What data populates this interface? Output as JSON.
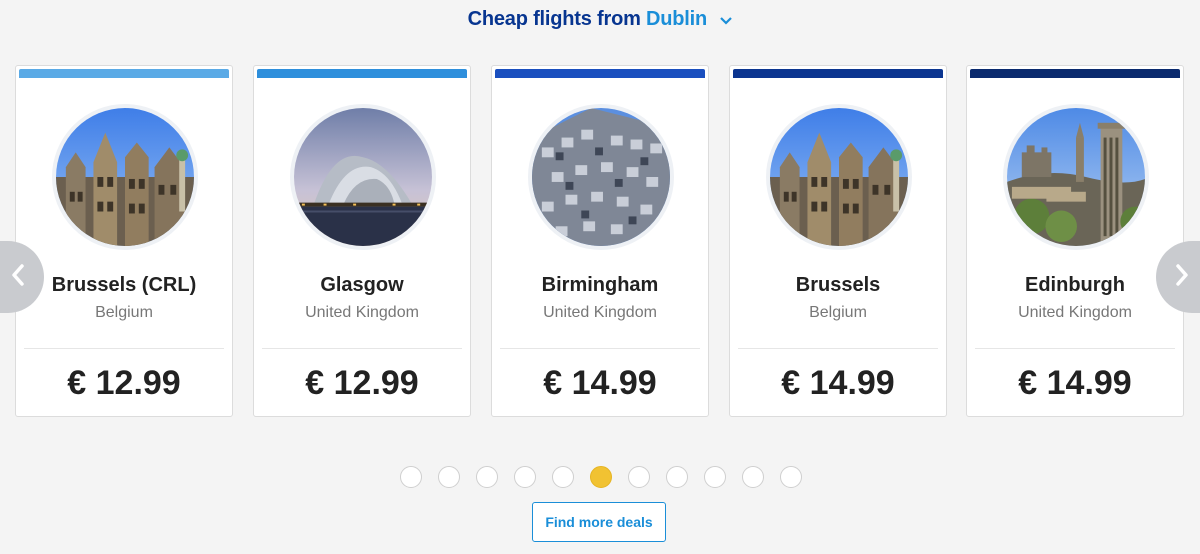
{
  "header": {
    "title_prefix": "Cheap flights from",
    "origin_city": "Dublin",
    "dropdown_icon": "chevron-down-icon",
    "accent_color": "#073590",
    "link_color": "#1a8ed8"
  },
  "carousel": {
    "prev_icon": "chevron-left-icon",
    "next_icon": "chevron-right-icon",
    "cards": [
      {
        "city": "Brussels (CRL)",
        "country": "Belgium",
        "price": "€ 12.99",
        "bar_color": "#5aaae6",
        "photo": "brussels-photo"
      },
      {
        "city": "Glasgow",
        "country": "United Kingdom",
        "price": "€ 12.99",
        "bar_color": "#2e8fdc",
        "photo": "glasgow-photo"
      },
      {
        "city": "Birmingham",
        "country": "United Kingdom",
        "price": "€ 14.99",
        "bar_color": "#1a4fbf",
        "photo": "birmingham-photo"
      },
      {
        "city": "Brussels",
        "country": "Belgium",
        "price": "€ 14.99",
        "bar_color": "#0b3590",
        "photo": "brussels-photo"
      },
      {
        "city": "Edinburgh",
        "country": "United Kingdom",
        "price": "€ 14.99",
        "bar_color": "#0a2a6e",
        "photo": "edinburgh-photo"
      }
    ]
  },
  "pagination": {
    "page_count": 11,
    "active_page": 6,
    "active_color": "#f1c232"
  },
  "cta": {
    "label": "Find more deals"
  }
}
